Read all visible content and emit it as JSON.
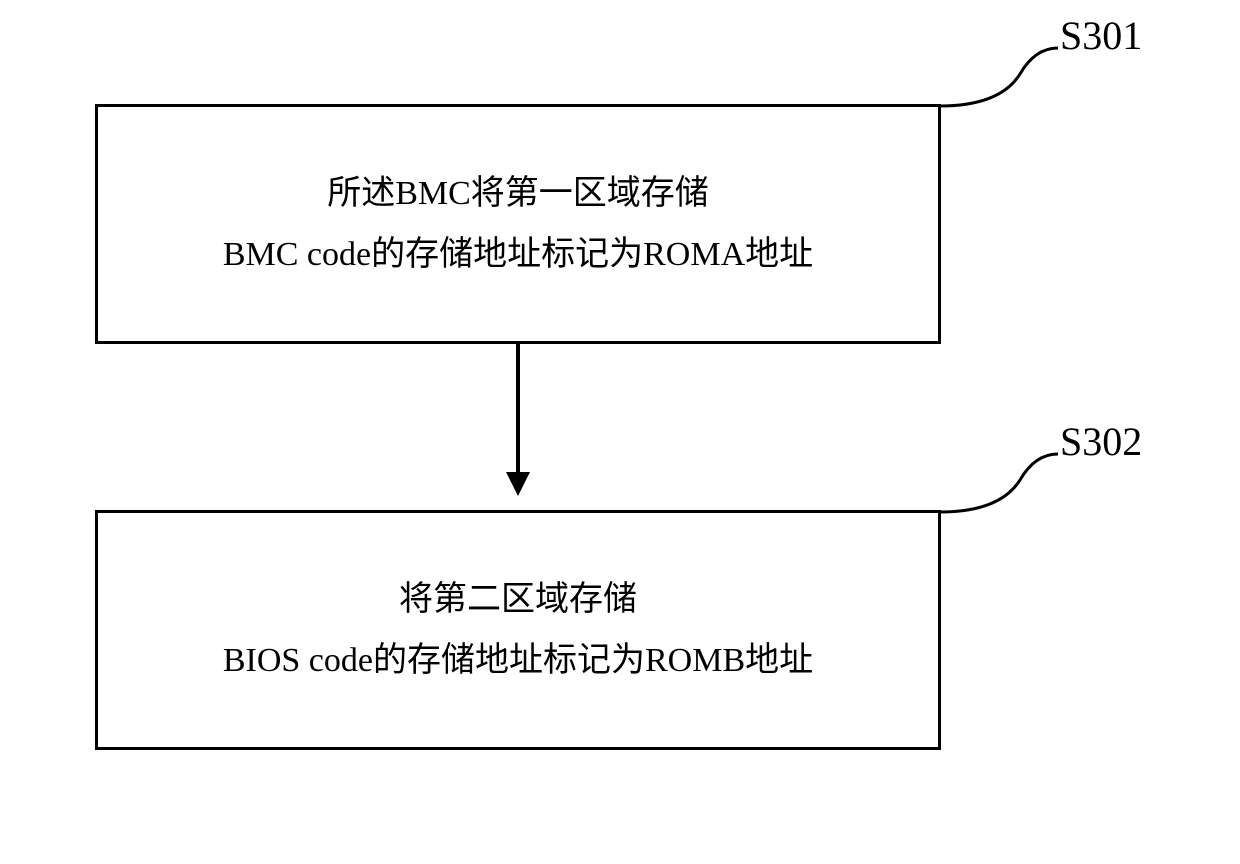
{
  "diagram": {
    "steps": [
      {
        "id": "S301",
        "line1": "所述BMC将第一区域存储",
        "line2": "BMC code的存储地址标记为ROMA地址"
      },
      {
        "id": "S302",
        "line1": "将第二区域存储",
        "line2": "BIOS code的存储地址标记为ROMB地址"
      }
    ]
  }
}
